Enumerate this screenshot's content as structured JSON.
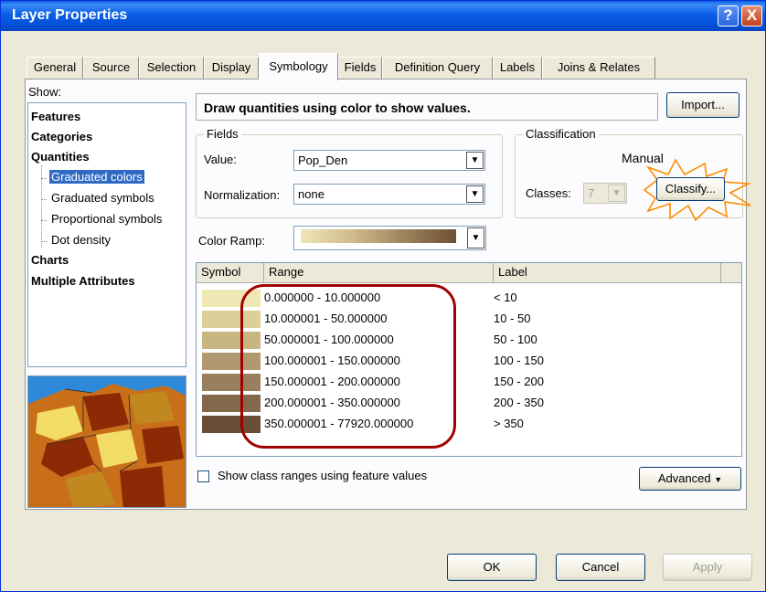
{
  "window": {
    "title": "Layer Properties",
    "help_glyph": "?",
    "close_glyph": "X"
  },
  "tabs": [
    {
      "label": "General"
    },
    {
      "label": "Source"
    },
    {
      "label": "Selection"
    },
    {
      "label": "Display"
    },
    {
      "label": "Symbology",
      "active": true
    },
    {
      "label": "Fields"
    },
    {
      "label": "Definition Query"
    },
    {
      "label": "Labels"
    },
    {
      "label": "Joins & Relates"
    }
  ],
  "show": {
    "label": "Show:",
    "items": [
      {
        "label": "Features",
        "bold": true
      },
      {
        "label": "Categories",
        "bold": true
      },
      {
        "label": "Quantities",
        "bold": true
      },
      {
        "label": "Graduated colors",
        "selected": true
      },
      {
        "label": "Graduated symbols"
      },
      {
        "label": "Proportional symbols"
      },
      {
        "label": "Dot density"
      },
      {
        "label": "Charts",
        "bold": true
      },
      {
        "label": "Multiple Attributes",
        "bold": true
      }
    ]
  },
  "description": "Draw quantities using color to show values.",
  "import_button": "Import...",
  "fields": {
    "title": "Fields",
    "value_label": "Value:",
    "value": "Pop_Den",
    "normalization_label": "Normalization:",
    "normalization": "none"
  },
  "classification": {
    "title": "Classification",
    "method": "Manual",
    "classes_label": "Classes:",
    "classes": "7",
    "classify_button": "Classify..."
  },
  "color_ramp_label": "Color Ramp:",
  "table": {
    "headers": {
      "symbol": "Symbol",
      "range": "Range",
      "label": "Label"
    },
    "rows": [
      {
        "color": "#f0e8b4",
        "range": "0.000000 - 10.000000",
        "label": "< 10"
      },
      {
        "color": "#dccf98",
        "range": "10.000001 - 50.000000",
        "label": "10 - 50"
      },
      {
        "color": "#c8b682",
        "range": "50.000001 - 100.000000",
        "label": "50 - 100"
      },
      {
        "color": "#b09870",
        "range": "100.000001 - 150.000000",
        "label": "100 - 150"
      },
      {
        "color": "#98805e",
        "range": "150.000001 - 200.000000",
        "label": "150 - 200"
      },
      {
        "color": "#82684c",
        "range": "200.000001 - 350.000000",
        "label": "200 - 350"
      },
      {
        "color": "#6b4e38",
        "range": "350.000001 - 77920.000000",
        "label": "> 350"
      }
    ]
  },
  "show_class_ranges_label": "Show class ranges using feature values",
  "advanced_button": "Advanced",
  "footer": {
    "ok": "OK",
    "cancel": "Cancel",
    "apply": "Apply"
  }
}
